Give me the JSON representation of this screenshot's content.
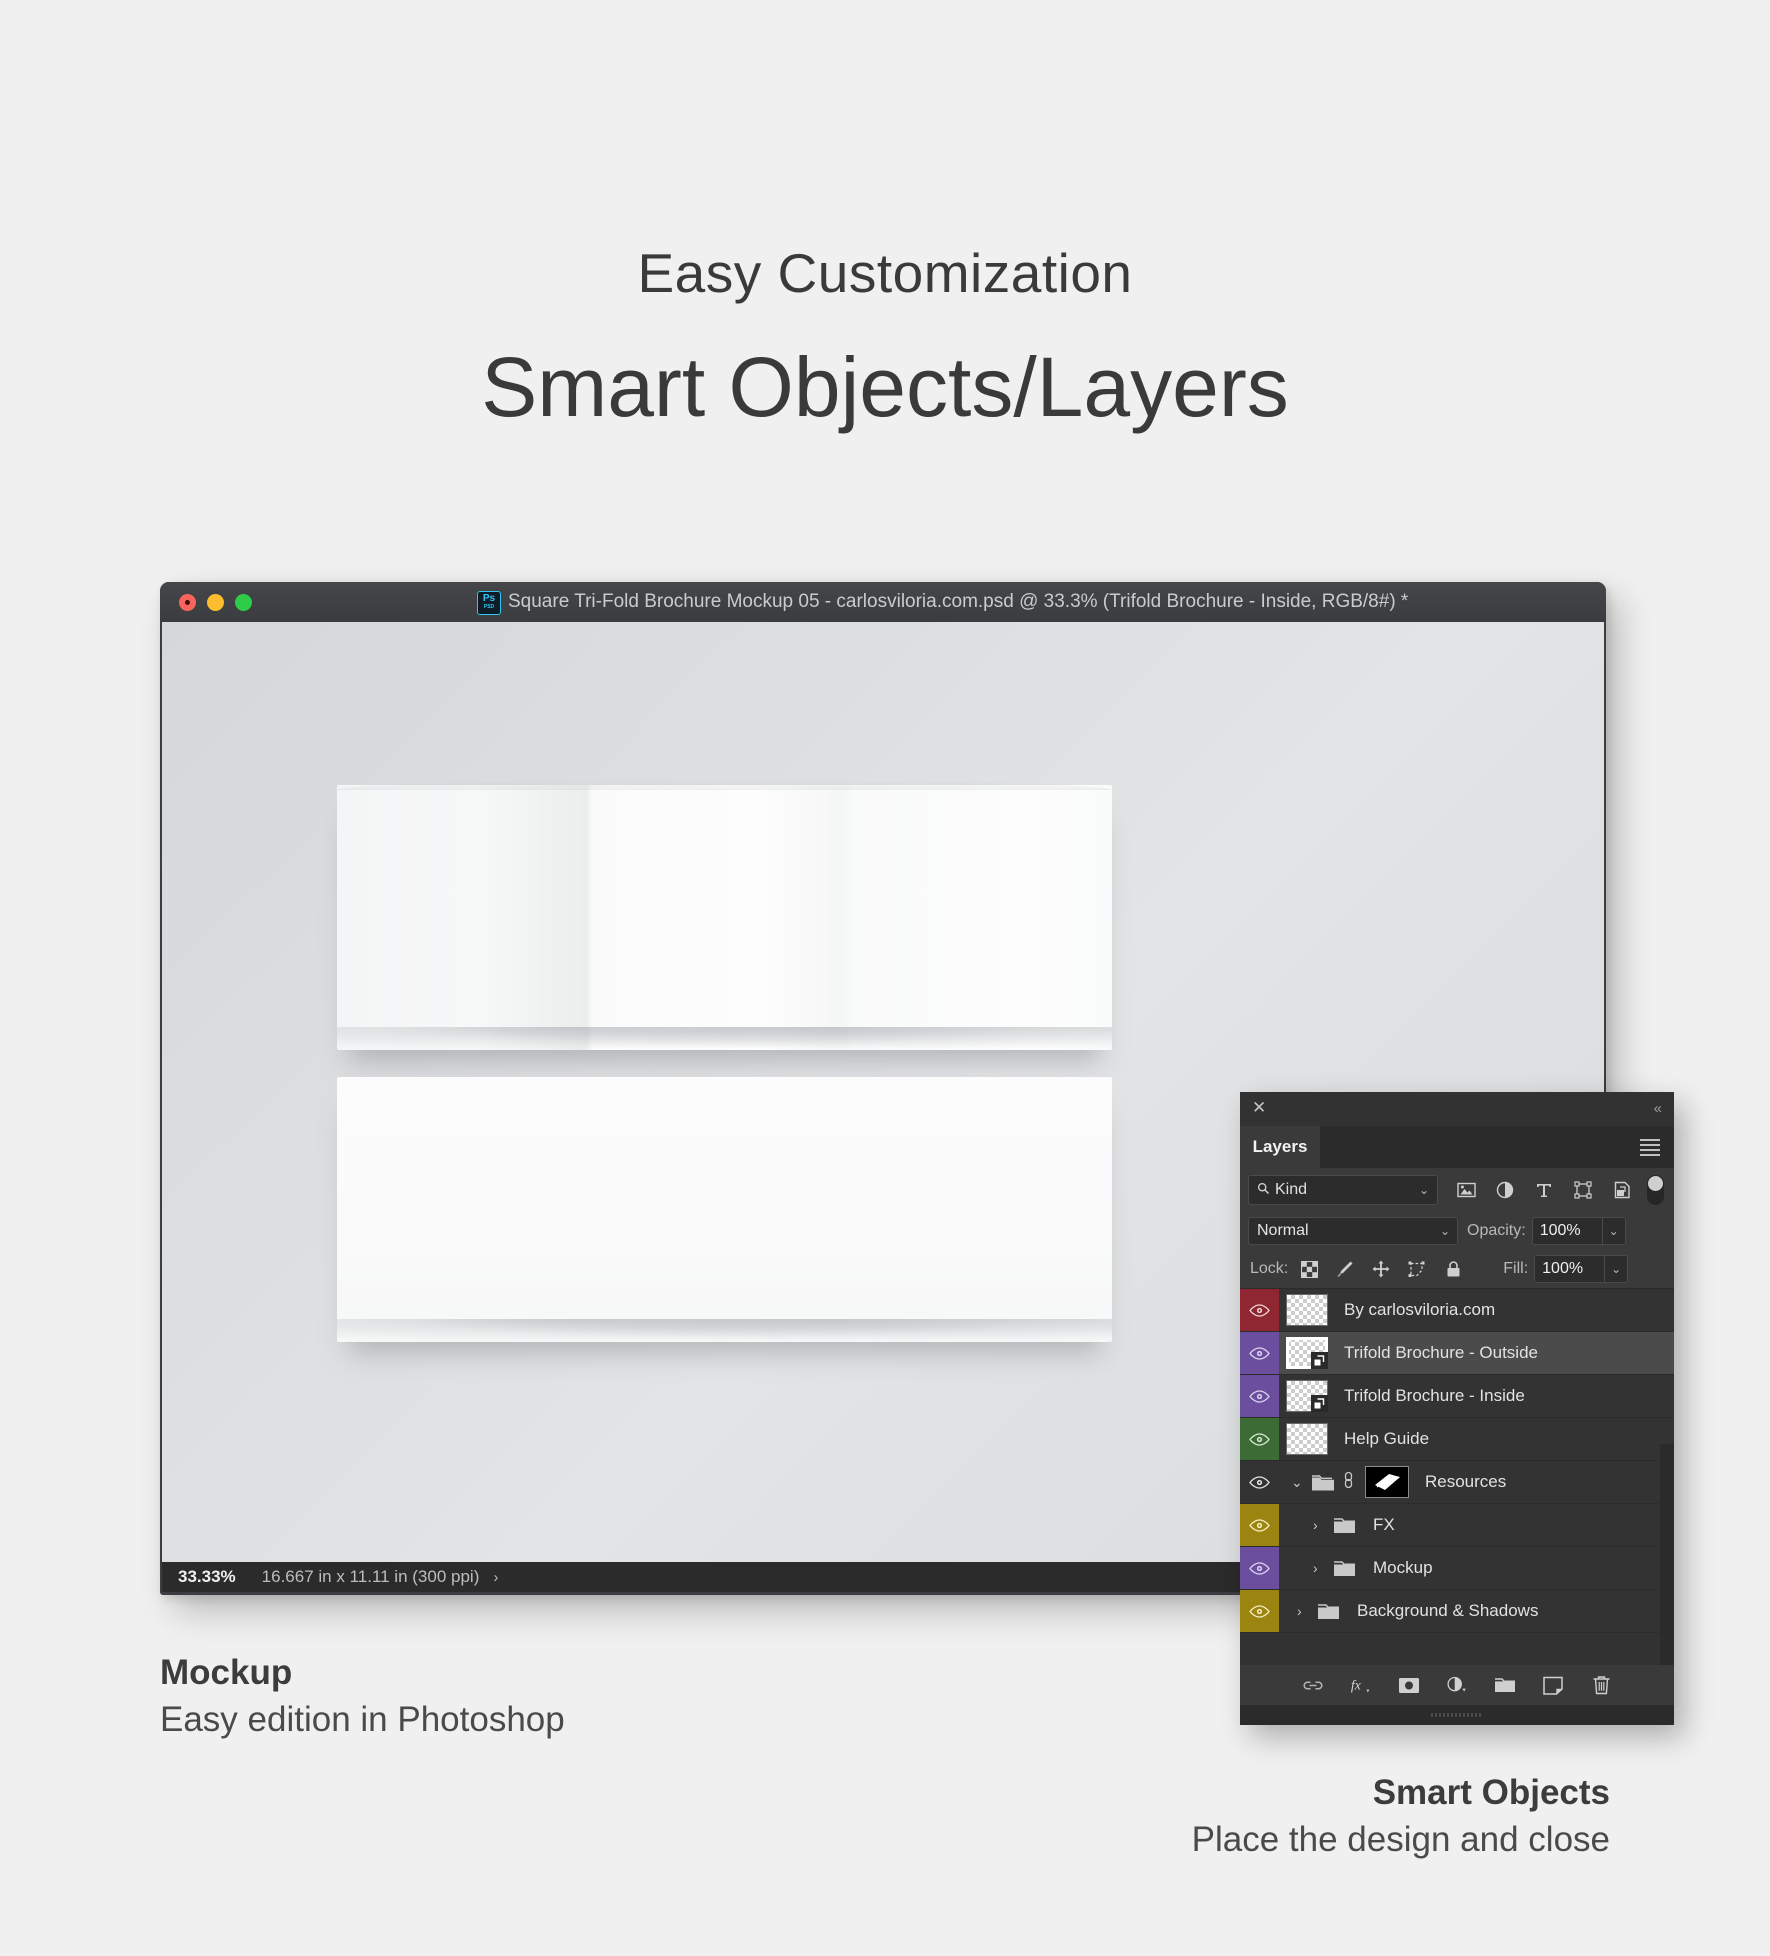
{
  "headings": {
    "subtitle": "Easy Customization",
    "title": "Smart Objects/Layers"
  },
  "photoshop_window": {
    "app_icon": {
      "label": "Ps",
      "sub": "PSD"
    },
    "title": "Square Tri-Fold Brochure Mockup 05 - carlosviloria.com.psd @ 33.3% (Trifold Brochure - Inside, RGB/8#) *",
    "traffic_lights": [
      "close-red",
      "minimize-yellow",
      "maximize-green"
    ],
    "status_bar": {
      "zoom": "33.33%",
      "dimensions": "16.667 in x 11.11 in (300 ppi)",
      "arrow": "›"
    }
  },
  "layers_panel": {
    "close_icon": "✕",
    "collapse_icon": "«",
    "tab_label": "Layers",
    "filter": {
      "kind_label": "Kind",
      "search_icon": "⚲",
      "caret": "⌄",
      "icon_buttons": [
        "pixel-layer-filter-icon",
        "adjustment-layer-filter-icon",
        "type-layer-filter-icon",
        "shape-layer-filter-icon",
        "smart-object-filter-icon"
      ],
      "toggle_name": "filter-enable-toggle"
    },
    "blend": {
      "mode": "Normal",
      "opacity_label": "Opacity:",
      "opacity_value": "100%"
    },
    "lock": {
      "lock_label": "Lock:",
      "icons": [
        "lock-transparent-pixels-icon",
        "lock-image-pixels-icon",
        "lock-position-icon",
        "lock-artboard-nesting-icon",
        "lock-all-icon"
      ],
      "fill_label": "Fill:",
      "fill_value": "100%"
    },
    "rows": [
      {
        "name": "By carlosviloria.com",
        "color": "#8e2731",
        "type": "layer",
        "selected": false,
        "visible": true
      },
      {
        "name": "Trifold Brochure - Outside",
        "color": "#6b4f9e",
        "type": "smart-object",
        "selected": true,
        "visible": true
      },
      {
        "name": "Trifold Brochure - Inside",
        "color": "#6b4f9e",
        "type": "smart-object",
        "selected": false,
        "visible": true
      },
      {
        "name": "Help Guide",
        "color": "#3d6b36",
        "type": "layer",
        "selected": false,
        "visible": true
      },
      {
        "name": "Resources",
        "color": "#333333",
        "type": "group-open-masked",
        "selected": false,
        "visible": true
      },
      {
        "name": "FX",
        "color": "#9c8410",
        "type": "group-closed",
        "selected": false,
        "visible": true
      },
      {
        "name": "Mockup",
        "color": "#6b4f9e",
        "type": "group-closed",
        "selected": false,
        "visible": true
      },
      {
        "name": "Background & Shadows",
        "color": "#9c8410",
        "type": "group-closed",
        "selected": false,
        "visible": true
      }
    ],
    "footer_buttons": [
      "link-layers-icon",
      "layer-style-fx-icon",
      "add-layer-mask-icon",
      "new-adjustment-layer-icon",
      "new-group-icon",
      "new-layer-icon",
      "delete-layer-icon"
    ]
  },
  "captions": {
    "left": {
      "title": "Mockup",
      "subtitle": "Easy edition in Photoshop"
    },
    "right": {
      "title": "Smart Objects",
      "subtitle": "Place the design and close"
    }
  },
  "colors": {
    "page_background": "#f0f0f0",
    "panel_background": "#323232",
    "row_background": "#333333",
    "row_selected": "#4b4b4b",
    "title_bar": "#3b3d40",
    "status_bar": "#2b2b2b"
  }
}
